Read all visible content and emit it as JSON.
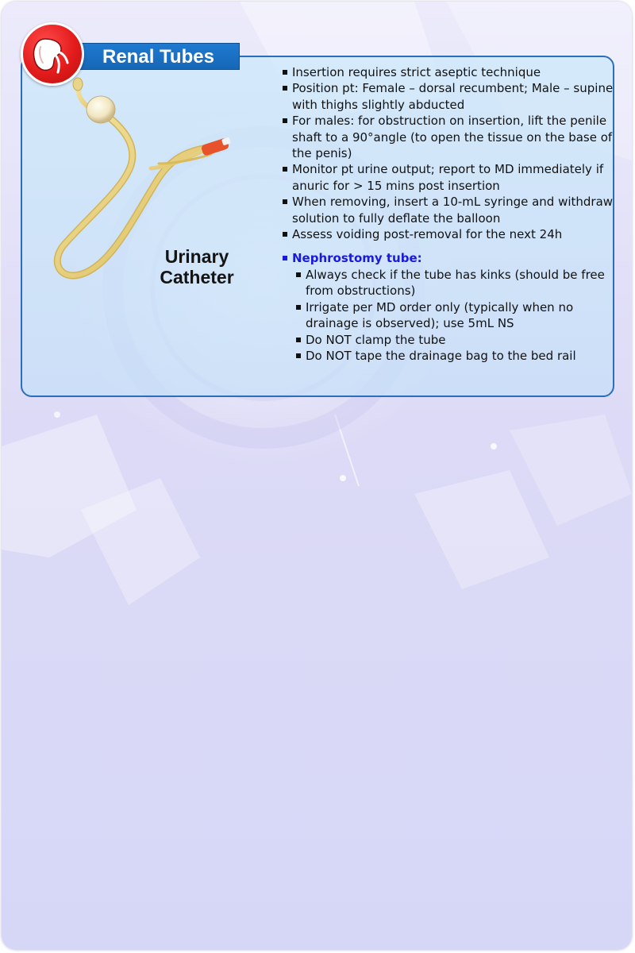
{
  "header": {
    "title": "Renal Tubes",
    "badge_icon": "kidney-icon"
  },
  "figure": {
    "label_line1": "Urinary",
    "label_line2": "Catheter"
  },
  "bullets": [
    "Insertion requires strict aseptic technique",
    "Position pt: Female – dorsal recumbent; Male – supine with thighs slightly abducted",
    "For males: for obstruction on insertion, lift the penile shaft to a 90°angle (to open the tissue on the base of the penis)",
    "Monitor pt urine output; report to MD immediately if anuric for > 15 mins post insertion",
    "When removing, insert a 10-mL syringe and withdraw solution to fully deflate the balloon",
    "Assess voiding post-removal for the next 24h"
  ],
  "nephrostomy": {
    "heading": "Nephrostomy tube:",
    "items": [
      "Always check if the tube has kinks (should be free from obstructions)",
      "Irrigate per MD order only (typically when no drainage is observed); use 5mL NS",
      "Do NOT clamp the tube",
      "Do NOT tape the drainage bag to the bed rail"
    ]
  },
  "colors": {
    "accent_blue": "#1e7ad0",
    "card_border": "#2a6fbc",
    "subheading_blue": "#1a1adc",
    "badge_red": "#e31b1b",
    "catheter_tube": "#e8cf79",
    "catheter_tip": "#e8522a"
  }
}
